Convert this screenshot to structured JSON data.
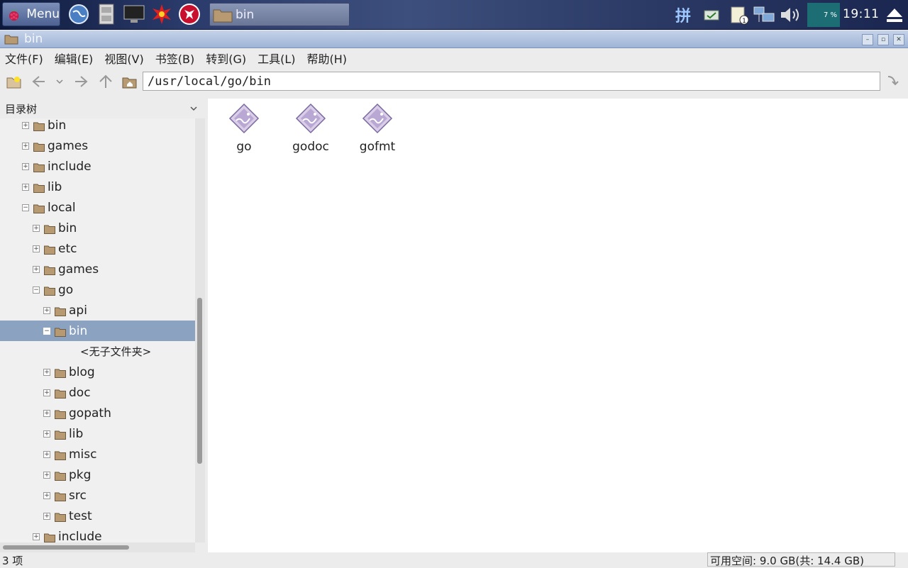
{
  "taskbar": {
    "menu_label": "Menu",
    "task_label": "bin",
    "ime": "拼",
    "cpu": "7 %",
    "clock": "19:11"
  },
  "window": {
    "title": "bin"
  },
  "menubar": [
    "文件(F)",
    "编辑(E)",
    "视图(V)",
    "书签(B)",
    "转到(G)",
    "工具(L)",
    "帮助(H)"
  ],
  "toolbar": {
    "path": "/usr/local/go/bin"
  },
  "sidebar": {
    "header": "目录树",
    "rows": [
      {
        "name": "bin",
        "depth": 0,
        "state": "collapsed"
      },
      {
        "name": "games",
        "depth": 0,
        "state": "collapsed"
      },
      {
        "name": "include",
        "depth": 0,
        "state": "collapsed"
      },
      {
        "name": "lib",
        "depth": 0,
        "state": "collapsed"
      },
      {
        "name": "local",
        "depth": 0,
        "state": "expanded"
      },
      {
        "name": "bin",
        "depth": 1,
        "state": "collapsed"
      },
      {
        "name": "etc",
        "depth": 1,
        "state": "collapsed"
      },
      {
        "name": "games",
        "depth": 1,
        "state": "collapsed"
      },
      {
        "name": "go",
        "depth": 1,
        "state": "expanded"
      },
      {
        "name": "api",
        "depth": 2,
        "state": "collapsed"
      },
      {
        "name": "bin",
        "depth": 2,
        "state": "expanded",
        "selected": true
      },
      {
        "name": "<无子文件夹>",
        "depth": 3,
        "state": "none"
      },
      {
        "name": "blog",
        "depth": 2,
        "state": "collapsed"
      },
      {
        "name": "doc",
        "depth": 2,
        "state": "collapsed"
      },
      {
        "name": "gopath",
        "depth": 2,
        "state": "collapsed"
      },
      {
        "name": "lib",
        "depth": 2,
        "state": "collapsed"
      },
      {
        "name": "misc",
        "depth": 2,
        "state": "collapsed"
      },
      {
        "name": "pkg",
        "depth": 2,
        "state": "collapsed"
      },
      {
        "name": "src",
        "depth": 2,
        "state": "collapsed"
      },
      {
        "name": "test",
        "depth": 2,
        "state": "collapsed"
      },
      {
        "name": "include",
        "depth": 1,
        "state": "collapsed"
      }
    ]
  },
  "files": [
    {
      "name": "go"
    },
    {
      "name": "godoc"
    },
    {
      "name": "gofmt"
    }
  ],
  "status": {
    "count": "3 项",
    "free": "可用空间: 9.0 GB(共: 14.4 GB)"
  }
}
